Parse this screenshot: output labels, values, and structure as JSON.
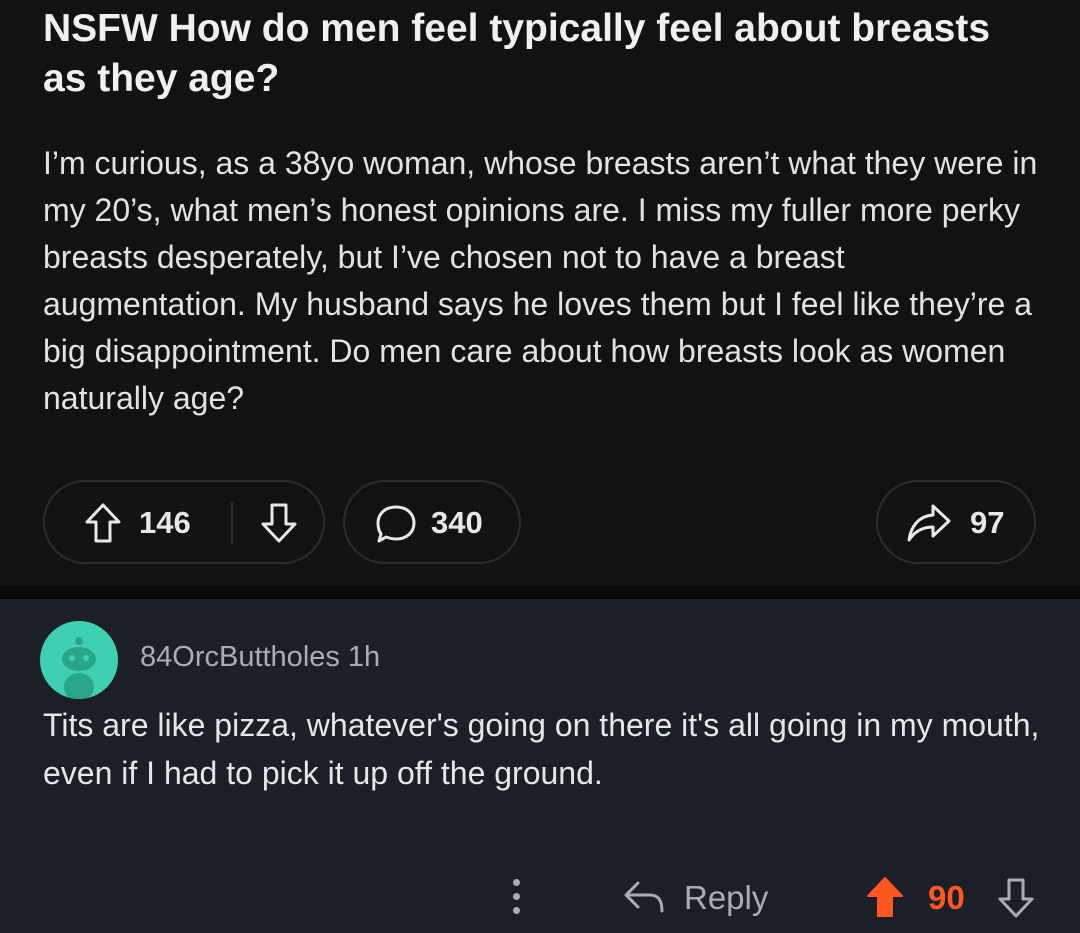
{
  "post": {
    "title": "NSFW How do men feel typically feel about breasts as they age?",
    "body": "I’m curious, as a 38yo woman, whose breasts aren’t what they were in my 20’s, what men’s honest opinions are. I miss my fuller more perky breasts desperately, but I’ve chosen not to have a breast augmentation. My husband says he loves them but I feel like they’re a big disappointment. Do men care about how breasts look as women naturally age?",
    "upvotes": "146",
    "comments": "340",
    "shares": "97"
  },
  "comment": {
    "username": "84OrcButtholes",
    "time": "1h",
    "text": "Tits are like pizza, whatever's going on there it's all going in my mouth, even if I had to pick it up off the ground.",
    "reply_label": "Reply",
    "score": "90"
  },
  "colors": {
    "post_bg": "#121212",
    "comment_bg": "#1b1f27",
    "upvote_active": "#ff5722",
    "avatar": "#3ed0b1"
  }
}
